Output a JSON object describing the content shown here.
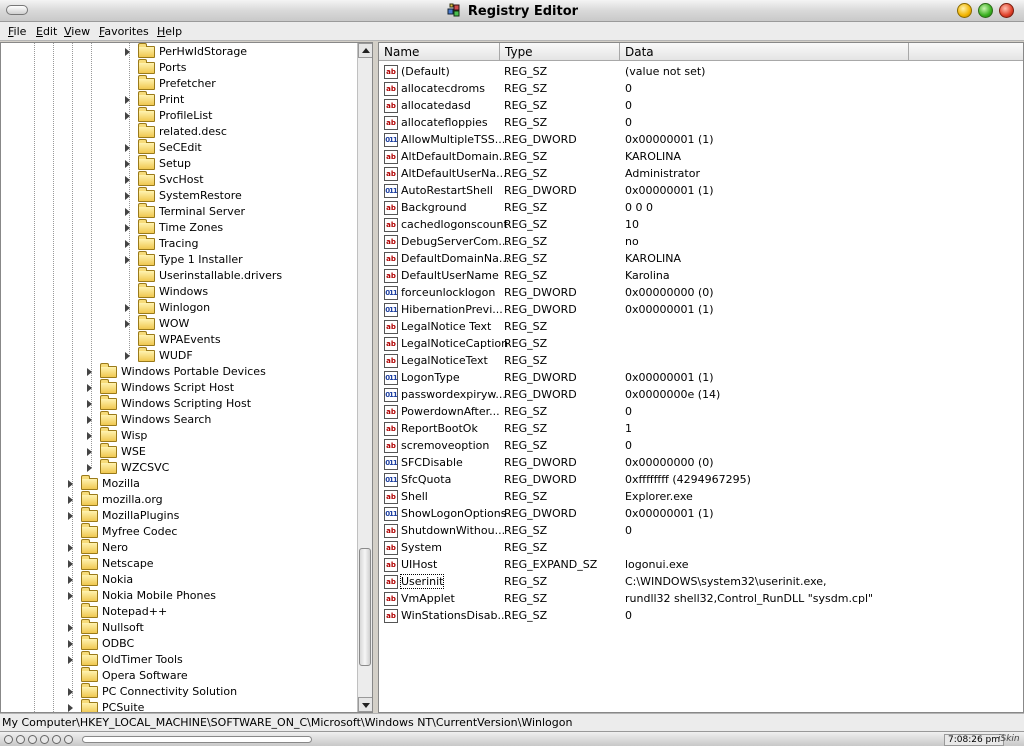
{
  "window": {
    "title": "Registry Editor"
  },
  "menu": [
    "File",
    "Edit",
    "View",
    "Favorites",
    "Help"
  ],
  "tree": {
    "items": [
      {
        "label": "PerHwIdStorage",
        "level": 3,
        "expandable": true
      },
      {
        "label": "Ports",
        "level": 3,
        "expandable": false
      },
      {
        "label": "Prefetcher",
        "level": 3,
        "expandable": false
      },
      {
        "label": "Print",
        "level": 3,
        "expandable": true
      },
      {
        "label": "ProfileList",
        "level": 3,
        "expandable": true
      },
      {
        "label": "related.desc",
        "level": 3,
        "expandable": false
      },
      {
        "label": "SeCEdit",
        "level": 3,
        "expandable": true
      },
      {
        "label": "Setup",
        "level": 3,
        "expandable": true
      },
      {
        "label": "SvcHost",
        "level": 3,
        "expandable": true
      },
      {
        "label": "SystemRestore",
        "level": 3,
        "expandable": true
      },
      {
        "label": "Terminal Server",
        "level": 3,
        "expandable": true
      },
      {
        "label": "Time Zones",
        "level": 3,
        "expandable": true
      },
      {
        "label": "Tracing",
        "level": 3,
        "expandable": true
      },
      {
        "label": "Type 1 Installer",
        "level": 3,
        "expandable": true
      },
      {
        "label": "Userinstallable.drivers",
        "level": 3,
        "expandable": false
      },
      {
        "label": "Windows",
        "level": 3,
        "expandable": false
      },
      {
        "label": "Winlogon",
        "level": 3,
        "expandable": true
      },
      {
        "label": "WOW",
        "level": 3,
        "expandable": true
      },
      {
        "label": "WPAEvents",
        "level": 3,
        "expandable": false
      },
      {
        "label": "WUDF",
        "level": 3,
        "expandable": true
      },
      {
        "label": "Windows Portable Devices",
        "level": 2,
        "expandable": true
      },
      {
        "label": "Windows Script Host",
        "level": 2,
        "expandable": true
      },
      {
        "label": "Windows Scripting Host",
        "level": 2,
        "expandable": true
      },
      {
        "label": "Windows Search",
        "level": 2,
        "expandable": true
      },
      {
        "label": "Wisp",
        "level": 2,
        "expandable": true
      },
      {
        "label": "WSE",
        "level": 2,
        "expandable": true
      },
      {
        "label": "WZCSVC",
        "level": 2,
        "expandable": true
      },
      {
        "label": "Mozilla",
        "level": 1,
        "expandable": true
      },
      {
        "label": "mozilla.org",
        "level": 1,
        "expandable": true
      },
      {
        "label": "MozillaPlugins",
        "level": 1,
        "expandable": true
      },
      {
        "label": "Myfree Codec",
        "level": 1,
        "expandable": false
      },
      {
        "label": "Nero",
        "level": 1,
        "expandable": true
      },
      {
        "label": "Netscape",
        "level": 1,
        "expandable": true
      },
      {
        "label": "Nokia",
        "level": 1,
        "expandable": true
      },
      {
        "label": "Nokia Mobile Phones",
        "level": 1,
        "expandable": true
      },
      {
        "label": "Notepad++",
        "level": 1,
        "expandable": false
      },
      {
        "label": "Nullsoft",
        "level": 1,
        "expandable": true
      },
      {
        "label": "ODBC",
        "level": 1,
        "expandable": true
      },
      {
        "label": "OldTimer Tools",
        "level": 1,
        "expandable": true
      },
      {
        "label": "Opera Software",
        "level": 1,
        "expandable": false
      },
      {
        "label": "PC Connectivity Solution",
        "level": 1,
        "expandable": true
      },
      {
        "label": "PCSuite",
        "level": 1,
        "expandable": true
      }
    ]
  },
  "list": {
    "columns": [
      "Name",
      "Type",
      "Data"
    ],
    "rows": [
      {
        "name": "(Default)",
        "type": "REG_SZ",
        "data": "(value not set)",
        "icon": "string-value-icon"
      },
      {
        "name": "allocatecdroms",
        "type": "REG_SZ",
        "data": "0",
        "icon": "string-value-icon"
      },
      {
        "name": "allocatedasd",
        "type": "REG_SZ",
        "data": "0",
        "icon": "string-value-icon"
      },
      {
        "name": "allocatefloppies",
        "type": "REG_SZ",
        "data": "0",
        "icon": "string-value-icon"
      },
      {
        "name": "AllowMultipleTSS...",
        "type": "REG_DWORD",
        "data": "0x00000001 (1)",
        "icon": "binary-value-icon"
      },
      {
        "name": "AltDefaultDomain...",
        "type": "REG_SZ",
        "data": "KAROLINA",
        "icon": "string-value-icon"
      },
      {
        "name": "AltDefaultUserNa...",
        "type": "REG_SZ",
        "data": "Administrator",
        "icon": "string-value-icon"
      },
      {
        "name": "AutoRestartShell",
        "type": "REG_DWORD",
        "data": "0x00000001 (1)",
        "icon": "binary-value-icon"
      },
      {
        "name": "Background",
        "type": "REG_SZ",
        "data": "0 0 0",
        "icon": "string-value-icon"
      },
      {
        "name": "cachedlogonscount",
        "type": "REG_SZ",
        "data": "10",
        "icon": "string-value-icon"
      },
      {
        "name": "DebugServerCom...",
        "type": "REG_SZ",
        "data": "no",
        "icon": "string-value-icon"
      },
      {
        "name": "DefaultDomainNa...",
        "type": "REG_SZ",
        "data": "KAROLINA",
        "icon": "string-value-icon"
      },
      {
        "name": "DefaultUserName",
        "type": "REG_SZ",
        "data": "Karolina",
        "icon": "string-value-icon"
      },
      {
        "name": "forceunlocklogon",
        "type": "REG_DWORD",
        "data": "0x00000000 (0)",
        "icon": "binary-value-icon"
      },
      {
        "name": "HibernationPrevi...",
        "type": "REG_DWORD",
        "data": "0x00000001 (1)",
        "icon": "binary-value-icon"
      },
      {
        "name": "LegalNotice Text",
        "type": "REG_SZ",
        "data": "",
        "icon": "string-value-icon"
      },
      {
        "name": "LegalNoticeCaption",
        "type": "REG_SZ",
        "data": "",
        "icon": "string-value-icon"
      },
      {
        "name": "LegalNoticeText",
        "type": "REG_SZ",
        "data": "",
        "icon": "string-value-icon"
      },
      {
        "name": "LogonType",
        "type": "REG_DWORD",
        "data": "0x00000001 (1)",
        "icon": "binary-value-icon"
      },
      {
        "name": "passwordexpiryw...",
        "type": "REG_DWORD",
        "data": "0x0000000e (14)",
        "icon": "binary-value-icon"
      },
      {
        "name": "PowerdownAfter...",
        "type": "REG_SZ",
        "data": "0",
        "icon": "string-value-icon"
      },
      {
        "name": "ReportBootOk",
        "type": "REG_SZ",
        "data": "1",
        "icon": "string-value-icon"
      },
      {
        "name": "scremoveoption",
        "type": "REG_SZ",
        "data": "0",
        "icon": "string-value-icon"
      },
      {
        "name": "SFCDisable",
        "type": "REG_DWORD",
        "data": "0x00000000 (0)",
        "icon": "binary-value-icon"
      },
      {
        "name": "SfcQuota",
        "type": "REG_DWORD",
        "data": "0xffffffff (4294967295)",
        "icon": "binary-value-icon"
      },
      {
        "name": "Shell",
        "type": "REG_SZ",
        "data": "Explorer.exe",
        "icon": "string-value-icon"
      },
      {
        "name": "ShowLogonOptions",
        "type": "REG_DWORD",
        "data": "0x00000001 (1)",
        "icon": "binary-value-icon"
      },
      {
        "name": "ShutdownWithou...",
        "type": "REG_SZ",
        "data": "0",
        "icon": "string-value-icon"
      },
      {
        "name": "System",
        "type": "REG_SZ",
        "data": "",
        "icon": "string-value-icon"
      },
      {
        "name": "UIHost",
        "type": "REG_EXPAND_SZ",
        "data": "logonui.exe",
        "icon": "string-value-icon"
      },
      {
        "name": "Userinit",
        "type": "REG_SZ",
        "data": "C:\\WINDOWS\\system32\\userinit.exe,",
        "icon": "string-value-icon",
        "focused": true
      },
      {
        "name": "VmApplet",
        "type": "REG_SZ",
        "data": "rundll32 shell32,Control_RunDLL \"sysdm.cpl\"",
        "icon": "string-value-icon"
      },
      {
        "name": "WinStationsDisab...",
        "type": "REG_SZ",
        "data": "0",
        "icon": "string-value-icon"
      }
    ]
  },
  "status": {
    "path": "My Computer\\HKEY_LOCAL_MACHINE\\SOFTWARE_ON_C\\Microsoft\\Windows NT\\CurrentVersion\\Winlogon"
  },
  "taskbar": {
    "clock": "7:08:26 pm",
    "skin_label": "iSkin"
  }
}
